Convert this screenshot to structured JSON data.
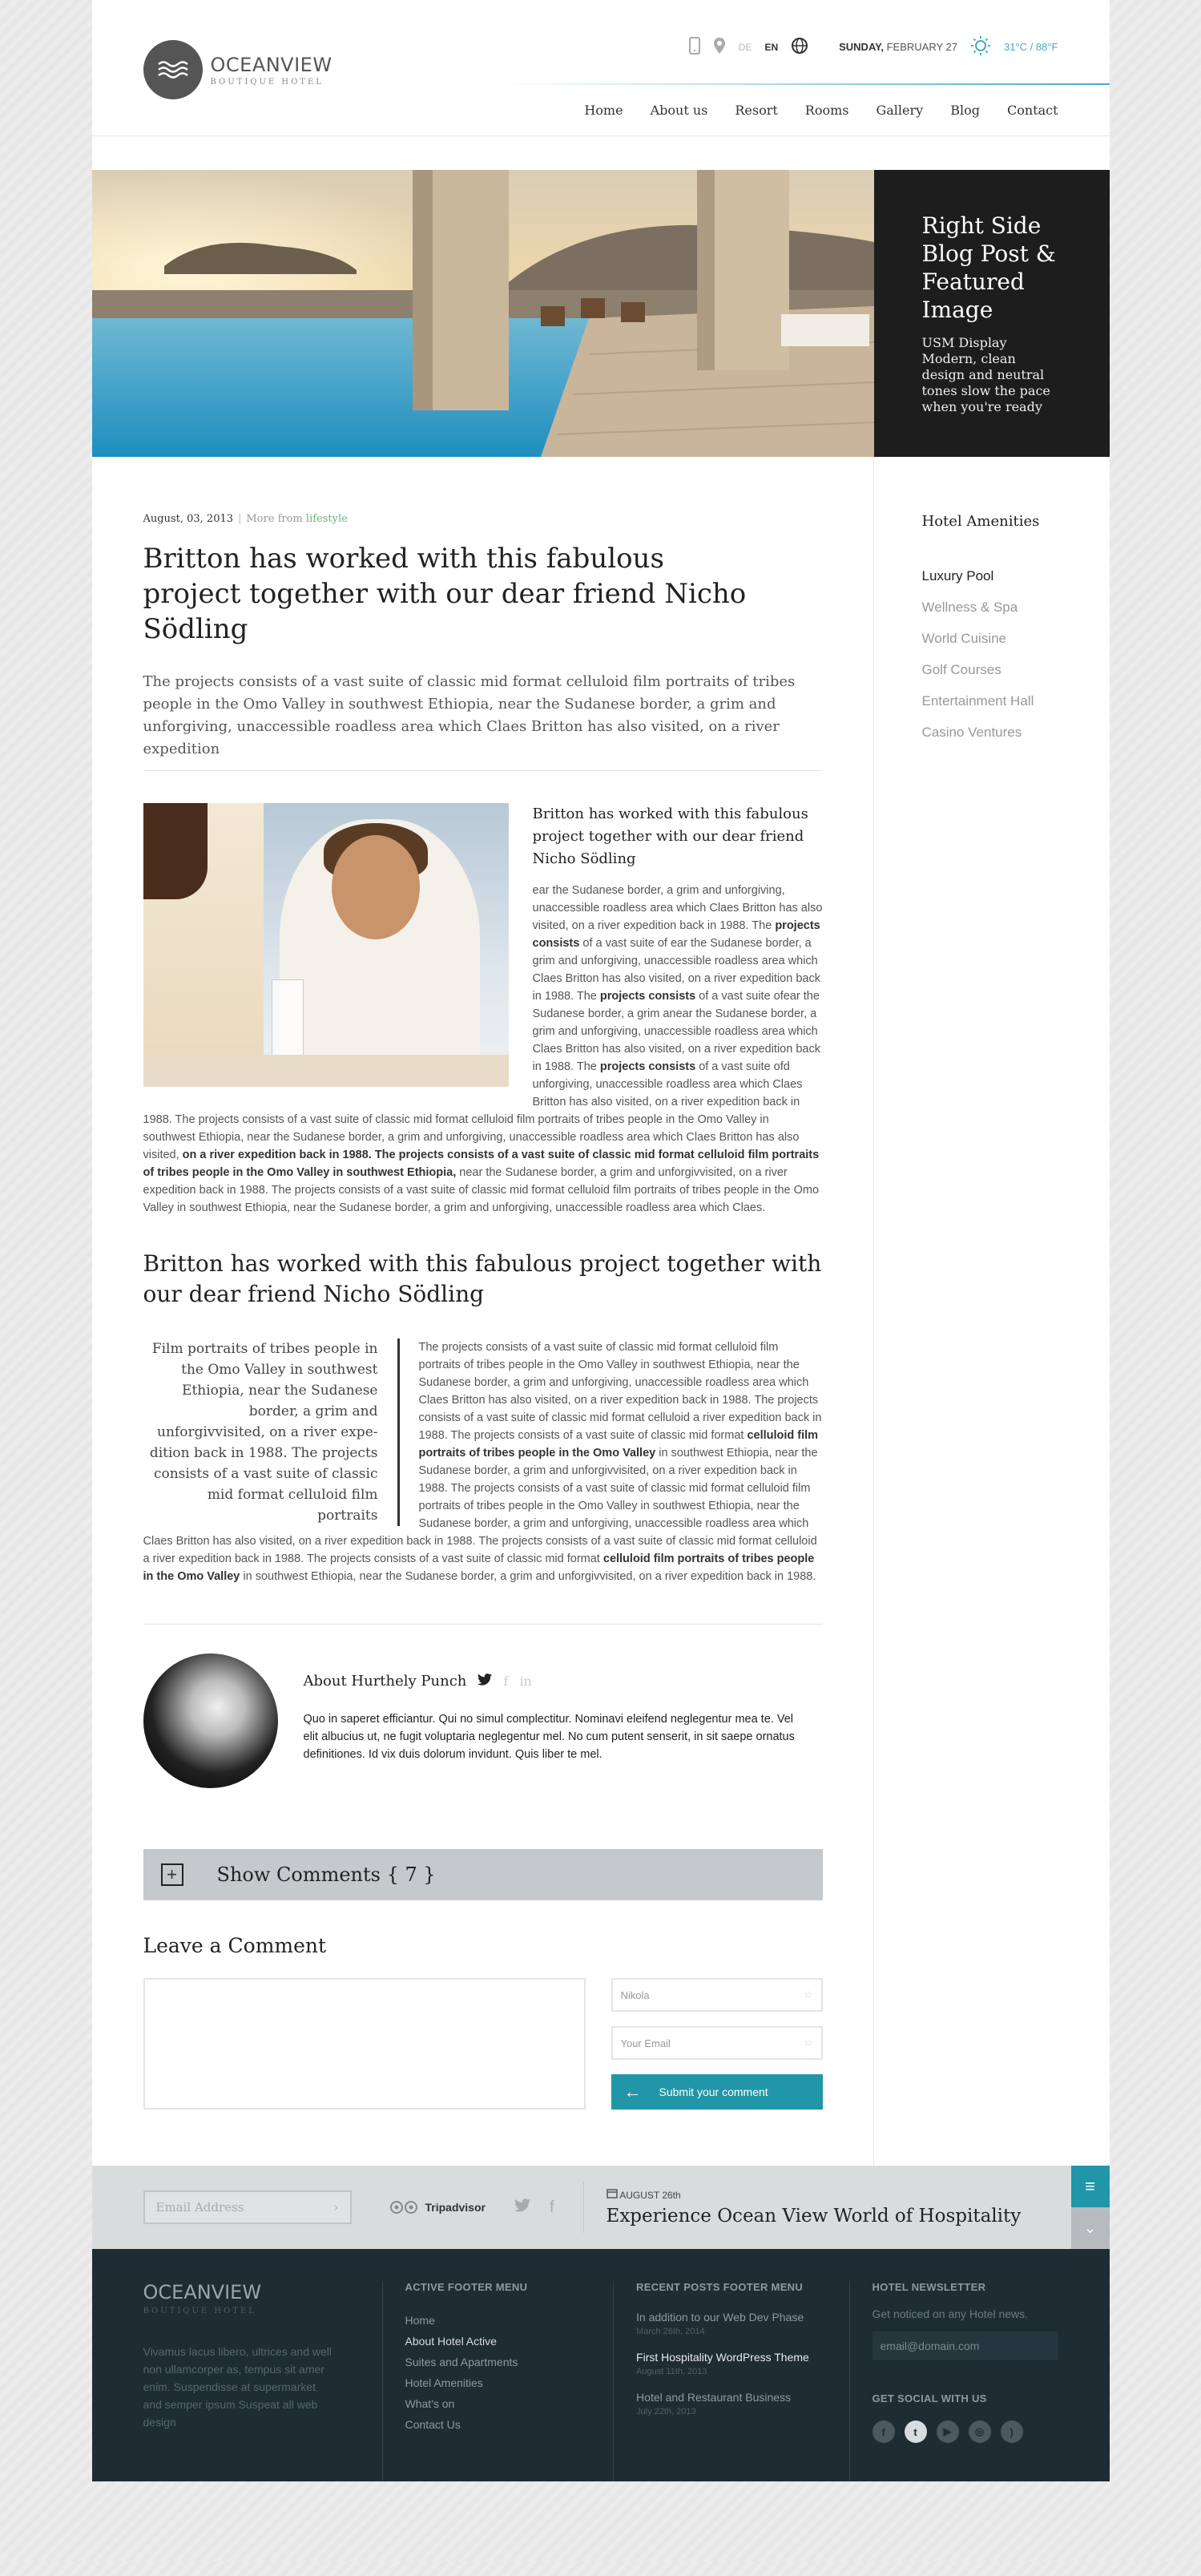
{
  "header": {
    "logo_title": "OCEANVIEW",
    "logo_sub": "BOUTIQUE HOTEL",
    "lang_de": "DE",
    "lang_en": "EN",
    "day": "SUNDAY,",
    "date": "FEBRUARY 27",
    "weather": "31°C / 88°F",
    "nav": [
      "Home",
      "About us",
      "Resort",
      "Rooms",
      "Gallery",
      "Blog",
      "Contact"
    ]
  },
  "hero": {
    "title": "Right Side Blog Post & Featured Image",
    "text": "USM Display Modern, clean design and neutral tones slow the pace when you're ready"
  },
  "post": {
    "date": "August, 03, 2013",
    "more_from": "More from",
    "category": "lifestyle",
    "title": "Britton has worked with this fabulous project together with our dear friend Nicho Södling",
    "lead": "The projects consists of a vast suite of classic mid format celluloid film portraits of tribes people in the Omo Valley in southwest Ethiopia, near the Sudanese border, a grim and unfor­giving, unaccessible roadless area which Claes Britton has also visited, on a river expedition",
    "block_title": "Britton has worked with this fabulous project together with our dear friend Nicho Södling",
    "p1a": "ear the Sudanese border, a grim and unforgiving, unaccessible roadless area which Claes Britton has also visited, on a river expedition back in 1988. The",
    "p1b": "projects consists",
    "p1c": "of a vast suite of ear the Sudanese border, a grim and unforgiving, unaccessible roadless area which Claes Britton has also visited, on a river expedition back in 1988. The",
    "p1d": "projects consists",
    "p1e": "of a vast suite ofear the Sudanese border, a grim anear the Sudanese border, a grim and unforgiving, unaccessible roadless area which Claes Britton has also visited, on a river expedition back in 1988. The",
    "p1f": "projects consists",
    "p1g": "of a vast suite ofd unforgiving, unaccessible roadless area which Claes Britton has also visited, on a river expedition back in 1988. The projects consists of a vast suite of classic mid format celluloid film portraits of tribes people in the Omo Valley in southwest Ethiopia, near the Sudanese border, a grim and unforgiving, unaccessible roadless area which Claes Britton has also visited,",
    "p1h": "on a river expedition back in 1988. The projects consists of a vast suite of classic mid format celluloid film portraits of tribes people in the Omo Valley in southwest Ethiopia,",
    "p1i": "near the Sudanese border, a grim and unforgivvisited, on a river expedition back in 1988. The projects consists of a vast suite of classic mid format celluloid film portraits of tribes people in the Omo Valley in southwest Ethiopia, near the Sudanese border, a grim and unforgiving, unaccessible roadless area which Claes.",
    "section_title": "Britton has worked with this fabulous project together with our dear friend Nicho Södling",
    "pullquote": "Film portraits of tribes people in the Omo Valley in southwest Ethiopia, near the Sudanese border, a grim and unforgivvisited, on a river expe­dition back in 1988. The projects consists of a vast suite of classic mid format celluloid film portraits",
    "p2a": "The projects consists of a vast suite of classic mid format cellu­loid film portraits of tribes people in the Omo Valley in southwest Ethiopia, near the Sudanese border, a grim and unforgiving, un­accessible roadless area which Claes Britton has also visited, on a river expedition back in 1988. The projects consists of a vast suite of classic mid format celluloid a river expedition back in 1988. The projects consists of a vast suite of classic mid format",
    "p2b": "celluloid film portraits of tribes people in the Omo Valley",
    "p2c": "in southwest Ethiopia, near the Sudanese border, a grim and unforgivvisited, on a river expedition back in 1988. The projects consists of a vast suite of classic mid format celluloid film portraits of tribes people in the Omo Valley in southwest Ethiopia, near the Sudanese border, a grim and unforgiving, unaccessible roadless area which Claes Britton has also visited, on a river expedition back in 1988. The projects consists of a vast suite of classic mid format celluloid a river expedition back in 1988. The projects consists of a vast suite of classic mid format",
    "p2d": "celluloid film portraits of tribes people in the Omo Valley",
    "p2e": "in southwest Ethiopia, near the Sudanese border, a grim and un­forgivvisited, on a river expedition back in 1988."
  },
  "author": {
    "name": "About Hurthely Punch",
    "bio": "Quo in saperet efficiantur. Qui no simul complectitur. Nominavi eleifend neglegentur mea te. Vel elit albucius ut, ne fugit voluptaria neglegentur mel. No cum putent senserit, in sit saepe ornatus definitiones. Id vix duis dolorum invidunt. Quis liber te mel."
  },
  "comments": {
    "show_label": "Show Comments { 7 }",
    "leave_title": "Leave a Comment",
    "name_value": "Nikola",
    "email_placeholder": "Your Email",
    "submit_label": "Submit your comment"
  },
  "sidebar": {
    "title": "Hotel Amenities",
    "items": [
      "Luxury Pool",
      "Wellness & Spa",
      "World Cuisine",
      "Golf Courses",
      "Entertainment Hall",
      "Casino Ventures"
    ]
  },
  "strip": {
    "email_placeholder": "Email Address",
    "tripadvisor": "Tripadvisor",
    "post_date": "AUGUST 26th",
    "post_title": "Experience Ocean View World of Hospitality"
  },
  "footer": {
    "logo_title": "OCEANVIEW",
    "logo_sub": "BOUTIQUE HOTEL",
    "about": "Vivamus lacus libero, ultrices and well non ullamcorper as, tempus sit amer enim. Suspend­isse at supermarket and semper ipsum Suspeat all web design",
    "menu_title": "ACTIVE FOOTER MENU",
    "menu": [
      "Home",
      "About Hotel Active",
      "Suites and Apartments",
      "Hotel Amenities",
      "What's on",
      "Contact Us"
    ],
    "posts_title": "RECENT POSTS FOOTER MENU",
    "posts": [
      {
        "title": "In addition to our Web Dev Phase",
        "date": "March 26th, 2014"
      },
      {
        "title": "First Hospitality WordPress Theme",
        "date": "August 11th, 2013"
      },
      {
        "title": "Hotel and Restaurant Business",
        "date": "July 22th, 2013"
      }
    ],
    "newsletter_title": "HOTEL NEWSLETTER",
    "newsletter_text": "Get noticed on any Hotel news.",
    "newsletter_placeholder": "email@domain.com",
    "social_title": "GET SOCIAL WITH US"
  },
  "colors": {
    "accent": "#2196a8",
    "category_link": "#6bb37c",
    "footer_bg": "#1e2c33",
    "hero_side_bg": "#1d1d1d"
  }
}
